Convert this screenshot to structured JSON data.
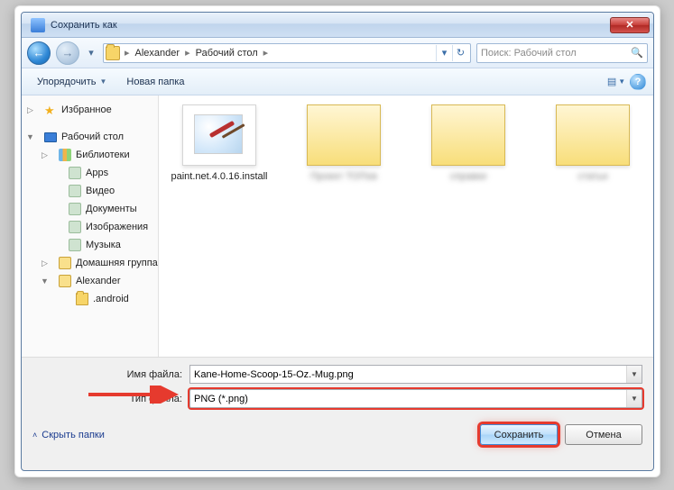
{
  "window": {
    "title": "Сохранить как"
  },
  "nav": {
    "path": [
      "Alexander",
      "Рабочий стол"
    ],
    "search_placeholder": "Поиск: Рабочий стол"
  },
  "toolbar": {
    "organize": "Упорядочить",
    "new_folder": "Новая папка"
  },
  "sidebar": {
    "favorites": "Избранное",
    "desktop": "Рабочий стол",
    "libraries": "Библиотеки",
    "lib_items": [
      "Apps",
      "Видео",
      "Документы",
      "Изображения",
      "Музыка"
    ],
    "homegroup": "Домашняя группа",
    "user": "Alexander",
    "user_sub": ".android"
  },
  "files": [
    {
      "name": "paint.net.4.0.16.install",
      "kind": "paint"
    },
    {
      "name": "Проект ТОПов",
      "kind": "generic",
      "blur": true
    },
    {
      "name": "справки",
      "kind": "generic",
      "blur": true
    },
    {
      "name": "статьи",
      "kind": "generic",
      "blur": true
    }
  ],
  "fields": {
    "filename_label": "Имя файла:",
    "filename_value": "Kane-Home-Scoop-15-Oz.-Mug.png",
    "filetype_label": "Тип файла:",
    "filetype_value": "PNG (*.png)"
  },
  "bottom": {
    "hide_folders": "Скрыть папки",
    "save": "Сохранить",
    "cancel": "Отмена"
  }
}
